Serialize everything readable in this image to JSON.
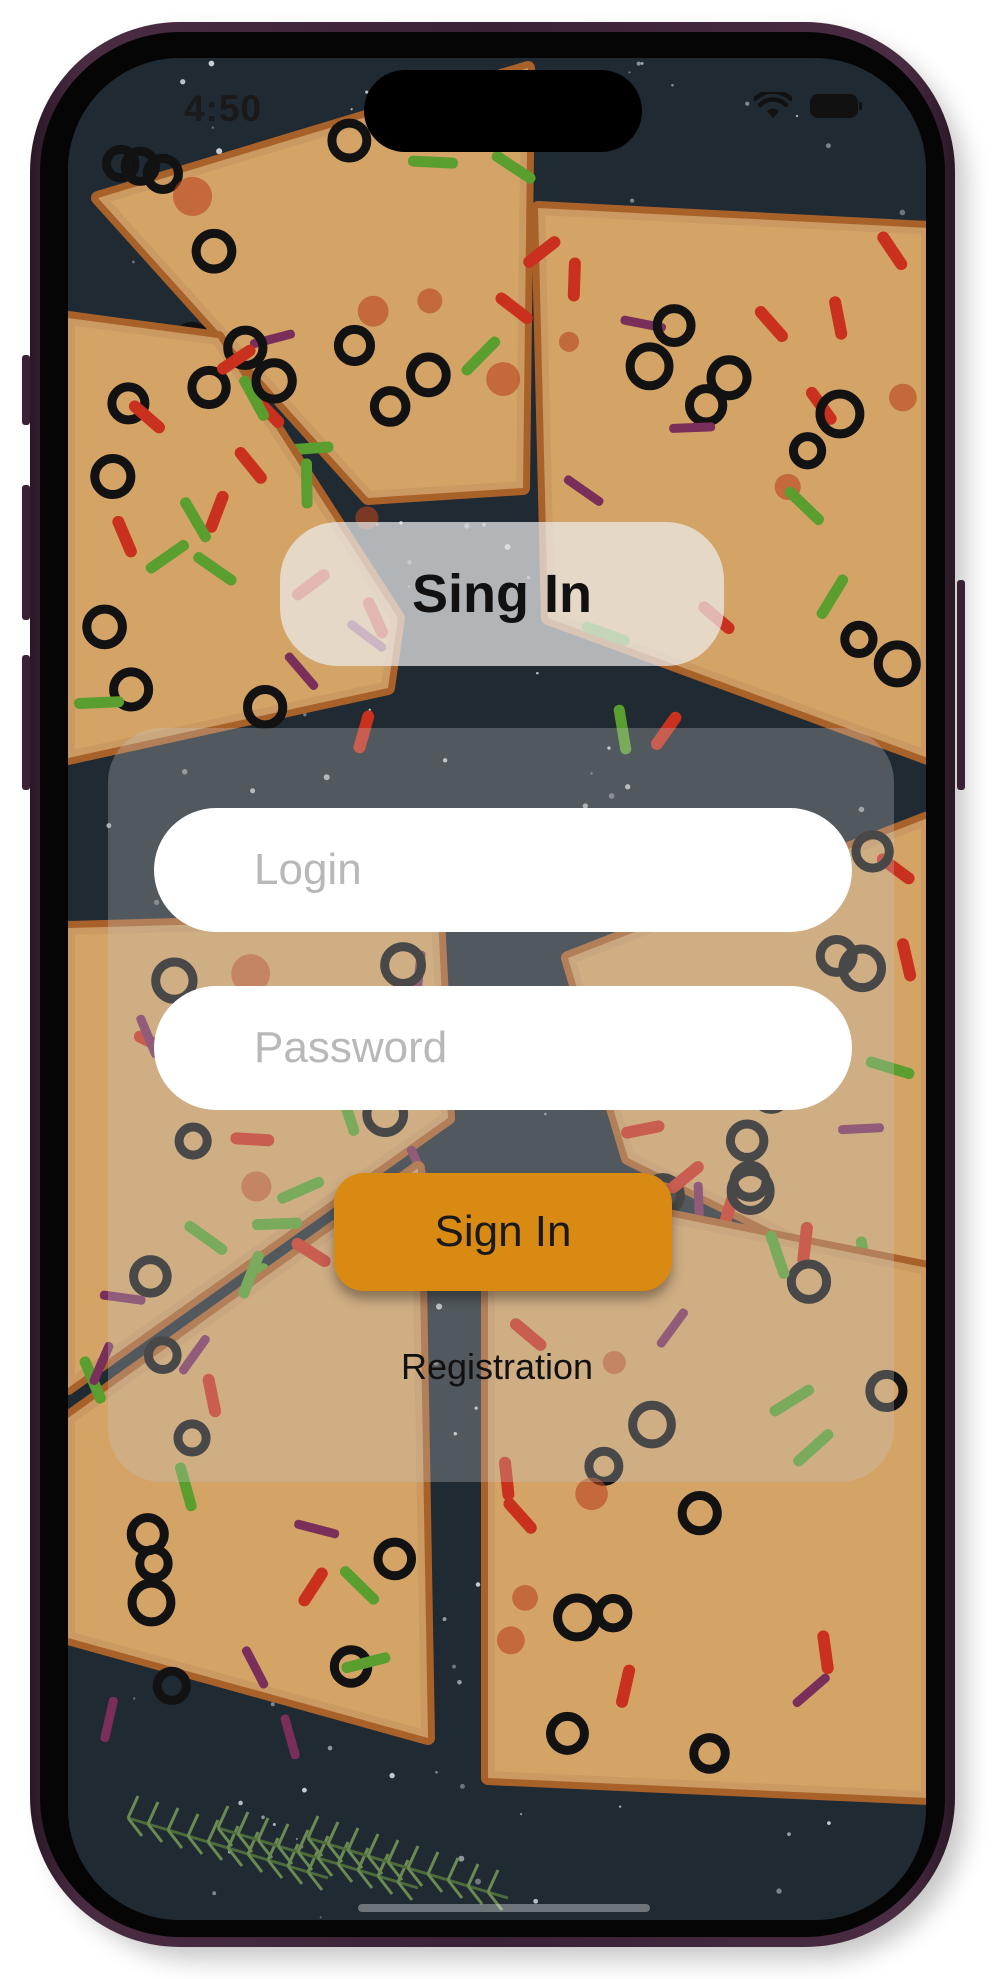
{
  "status_bar": {
    "time": "4:50",
    "wifi_icon": "wifi-icon",
    "battery_icon": "battery-icon"
  },
  "auth": {
    "title": "Sing In",
    "login": {
      "value": "",
      "placeholder": "Login"
    },
    "password": {
      "value": "",
      "placeholder": "Password"
    },
    "submit_label": "Sign In",
    "registration_label": "Registration"
  },
  "colors": {
    "accent_button": "#d98a12",
    "field_background": "#ffffff",
    "placeholder": "#b8b8b8",
    "board_background": "#1f2a33"
  },
  "background": {
    "image_subject": "pizza-slices-on-dark-board"
  }
}
